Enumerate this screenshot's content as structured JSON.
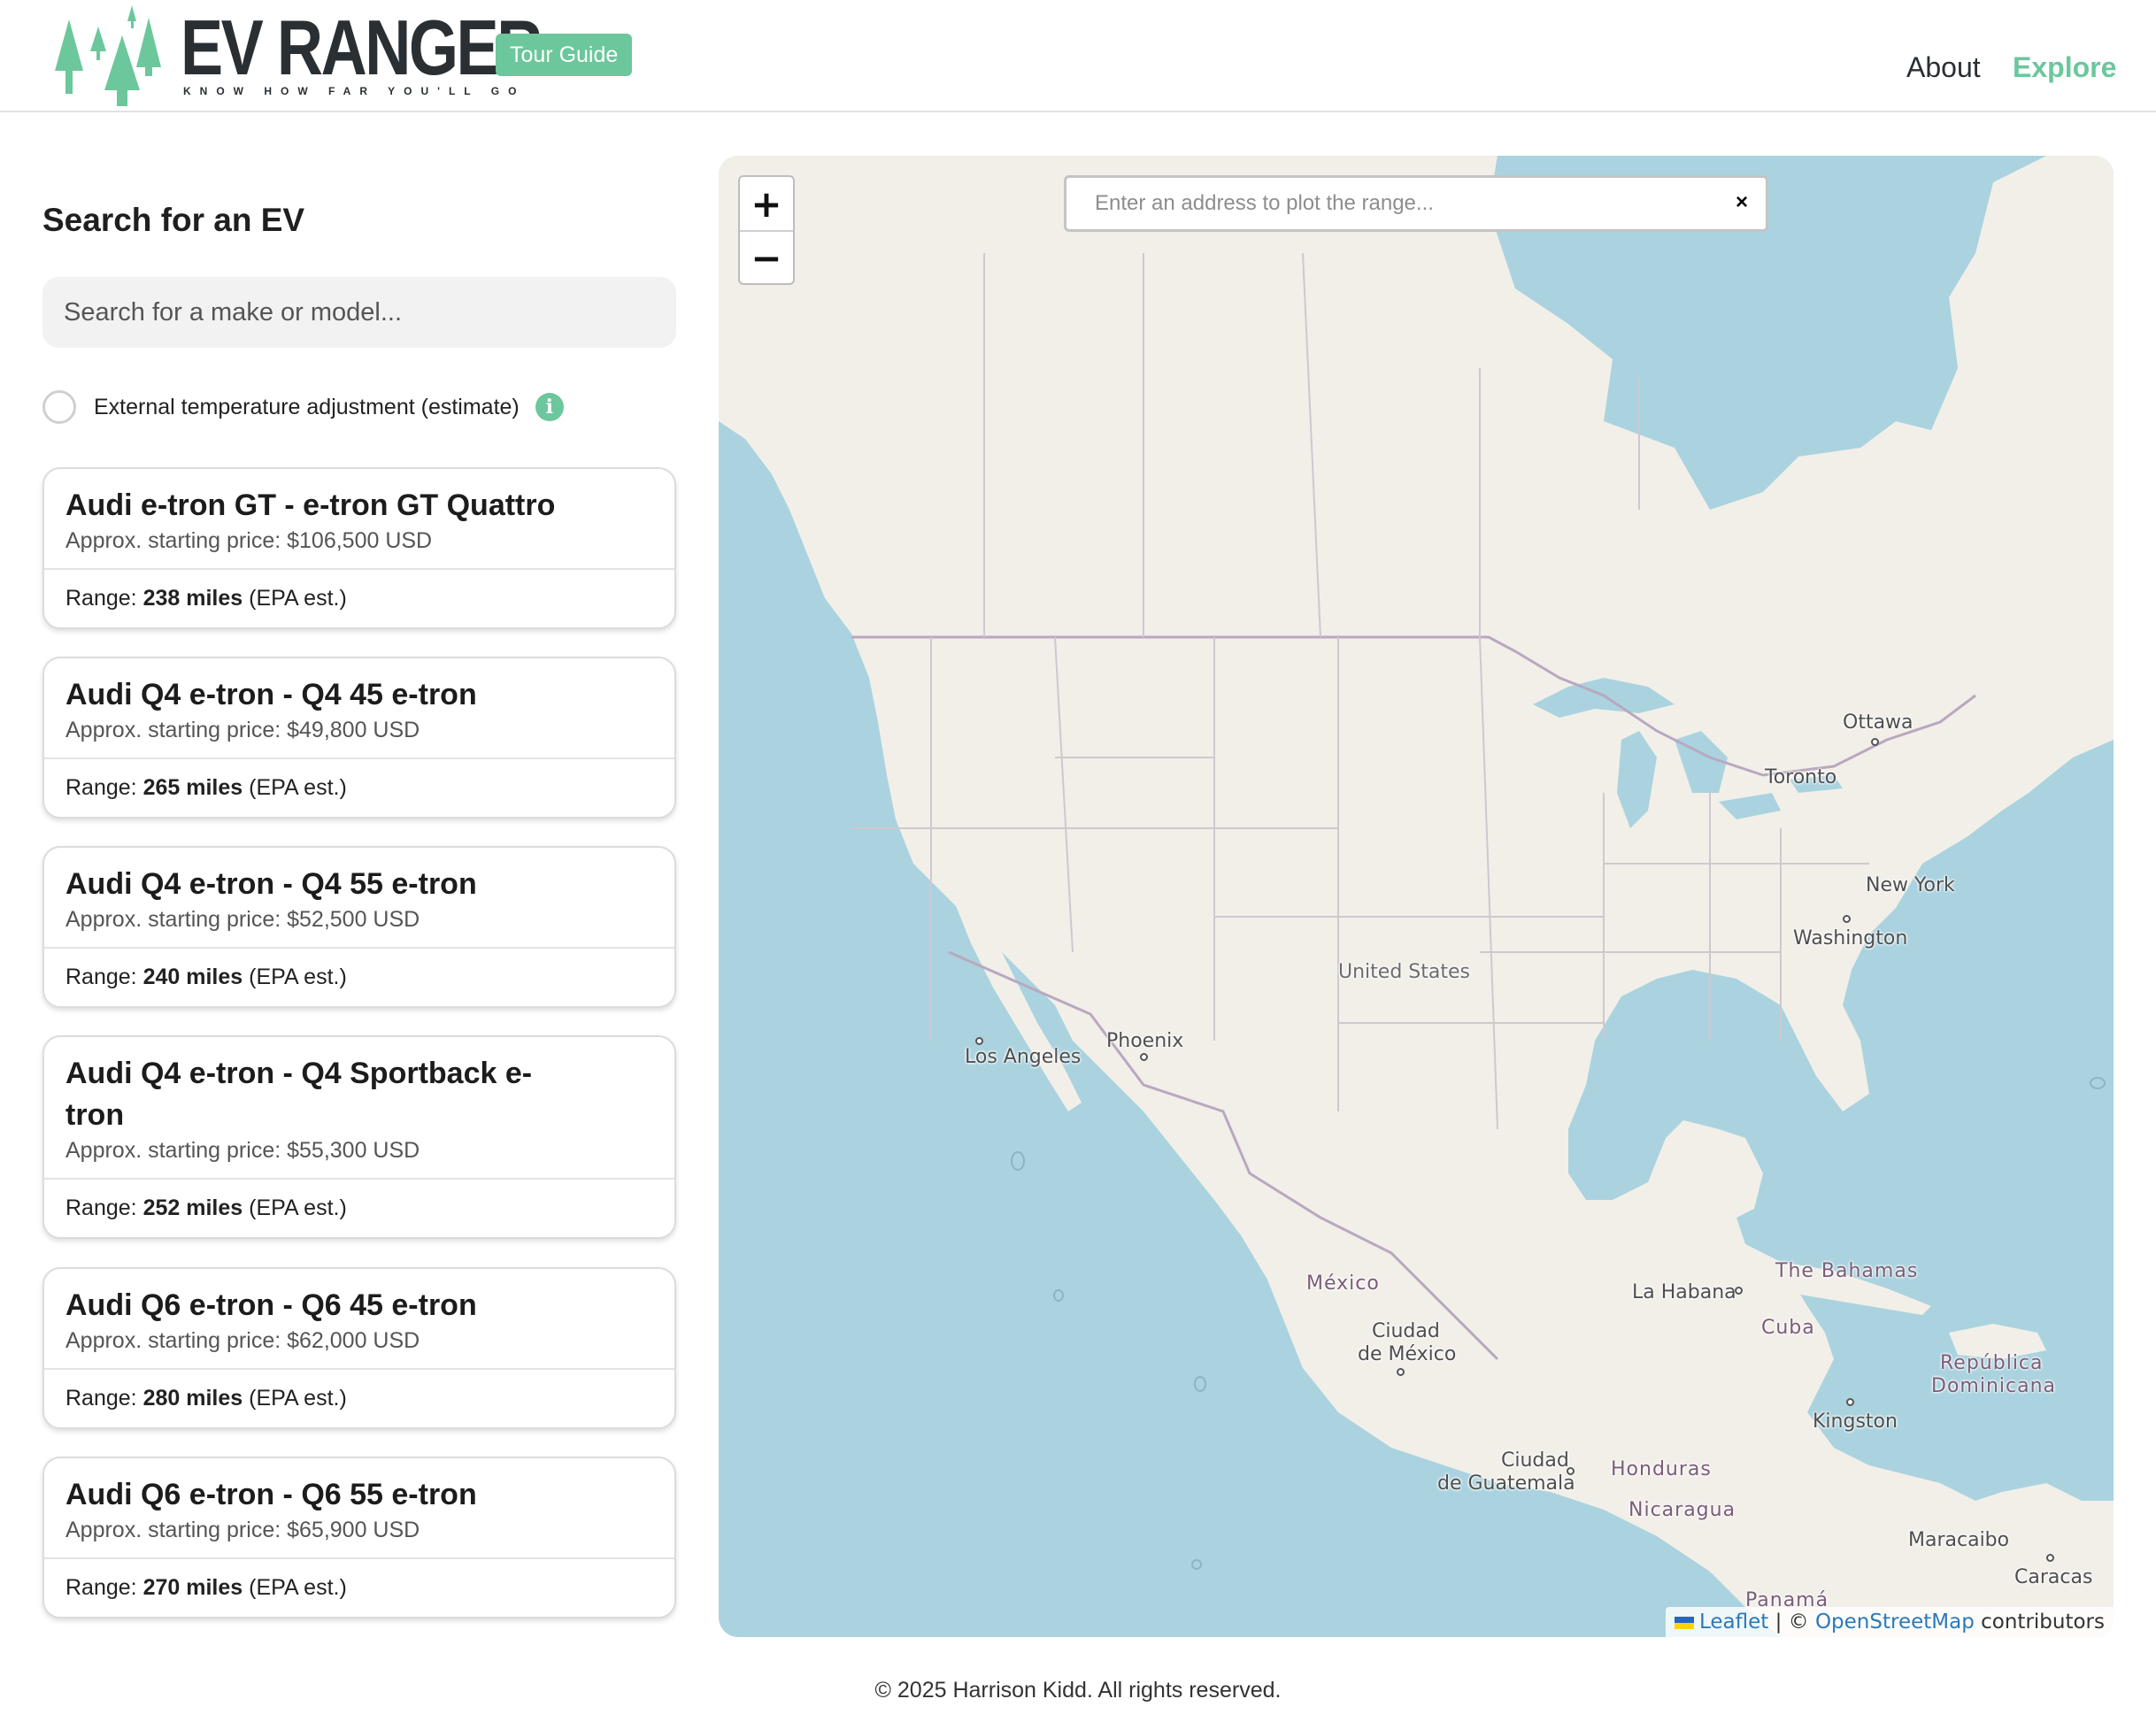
{
  "header": {
    "brand": "EV RANGER",
    "tagline": "KNOW HOW FAR YOU'LL GO",
    "tour_button": "Tour Guide",
    "nav": {
      "about": "About",
      "explore": "Explore"
    }
  },
  "colors": {
    "accent": "#6cc79c",
    "text_dark": "#2a2f33",
    "water": "#aad3df",
    "land": "#f2efe9"
  },
  "sidebar": {
    "title": "Search for an EV",
    "search_placeholder": "Search for a make or model...",
    "temp_label": "External temperature adjustment (estimate)",
    "info_icon": "i",
    "range_prefix": "Range:",
    "range_suffix": "(EPA est.)",
    "cards": [
      {
        "title": "Audi e-tron GT - e-tron GT Quattro",
        "price": "Approx. starting price: $106,500 USD",
        "range": "238 miles"
      },
      {
        "title": "Audi Q4 e-tron - Q4 45 e-tron",
        "price": "Approx. starting price: $49,800 USD",
        "range": "265 miles"
      },
      {
        "title": "Audi Q4 e-tron - Q4 55 e-tron",
        "price": "Approx. starting price: $52,500 USD",
        "range": "240 miles"
      },
      {
        "title": "Audi Q4 e-tron - Q4 Sportback e-tron",
        "price": "Approx. starting price: $55,300 USD",
        "range": "252 miles"
      },
      {
        "title": "Audi Q6 e-tron - Q6 45 e-tron",
        "price": "Approx. starting price: $62,000 USD",
        "range": "280 miles"
      },
      {
        "title": "Audi Q6 e-tron - Q6 55 e-tron",
        "price": "Approx. starting price: $65,900 USD",
        "range": "270 miles"
      }
    ]
  },
  "map": {
    "zoom_in": "+",
    "zoom_out": "−",
    "address_placeholder": "Enter an address to plot the range...",
    "clear": "×",
    "labels": {
      "ottawa": "Ottawa",
      "toronto": "Toronto",
      "new_york": "New York",
      "washington": "Washington",
      "united_states": "United States",
      "phoenix": "Phoenix",
      "los_angeles": "Los Angeles",
      "mexico": "México",
      "ciudad_mexico_1": "Ciudad",
      "ciudad_mexico_2": "de México",
      "la_habana": "La Habana",
      "bahamas": "The Bahamas",
      "cuba": "Cuba",
      "republica_1": "República",
      "republica_2": "Dominicana",
      "kingston": "Kingston",
      "ciudad_guatemala_1": "Ciudad",
      "ciudad_guatemala_2": "de Guatemala",
      "honduras": "Honduras",
      "nicaragua": "Nicaragua",
      "maracaibo": "Maracaibo",
      "caracas": "Caracas",
      "panama": "Panamá"
    },
    "attribution": {
      "leaflet": "Leaflet",
      "sep": "| ©",
      "osm": "OpenStreetMap",
      "contributors": "contributors"
    }
  },
  "footer": "© 2025 Harrison Kidd. All rights reserved."
}
